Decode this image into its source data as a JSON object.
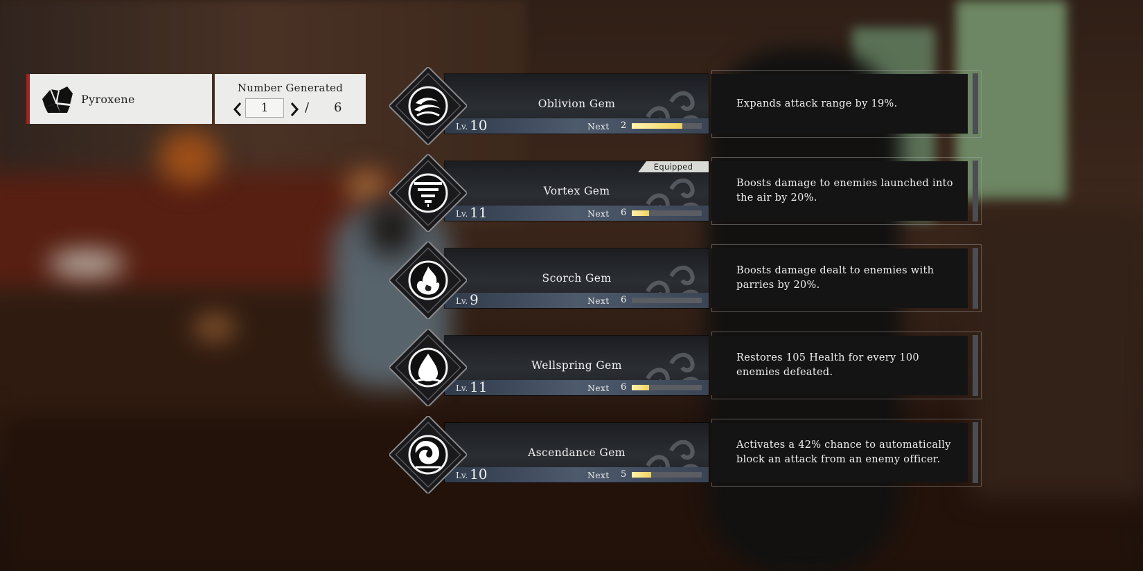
{
  "item": {
    "name": "Pyroxene",
    "icon": "pyroxene-rock-icon"
  },
  "counter": {
    "label": "Number Generated",
    "current": "1",
    "separator": "/",
    "max": "6"
  },
  "level_prefix": "Lv.",
  "next_label": "Next",
  "equipped_label": "Equipped",
  "gems": [
    {
      "name": "Oblivion Gem",
      "level": "10",
      "next": "2",
      "progress": 0.72,
      "equipped": false,
      "description": "Expands attack range by 19%.",
      "icon": "oblivion-waves-icon"
    },
    {
      "name": "Vortex Gem",
      "level": "11",
      "next": "6",
      "progress": 0.25,
      "equipped": true,
      "description": "Boosts damage to enemies launched into the air by 20%.",
      "icon": "vortex-tornado-icon"
    },
    {
      "name": "Scorch Gem",
      "level": "9",
      "next": "6",
      "progress": 0.0,
      "equipped": false,
      "description": "Boosts damage dealt to enemies with parries by 20%.",
      "icon": "scorch-flame-icon"
    },
    {
      "name": "Wellspring Gem",
      "level": "11",
      "next": "6",
      "progress": 0.25,
      "equipped": false,
      "description": "Restores 105 Health for every 100 enemies defeated.",
      "icon": "wellspring-drop-icon"
    },
    {
      "name": "Ascendance Gem",
      "level": "10",
      "next": "5",
      "progress": 0.28,
      "equipped": false,
      "description": "Activates a 42% chance to automatically block an attack from an enemy officer.",
      "icon": "ascendance-swirl-icon"
    }
  ]
}
